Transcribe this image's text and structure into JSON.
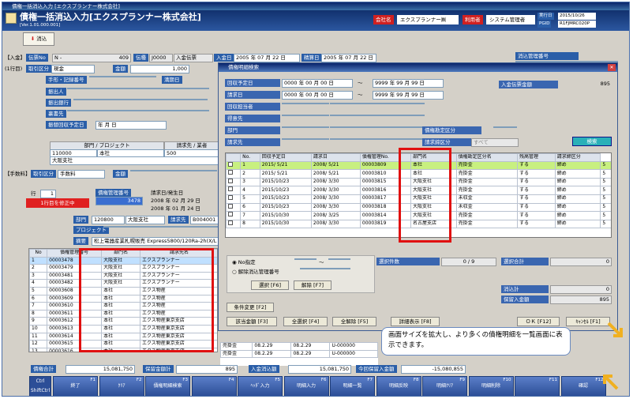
{
  "window": {
    "title": "債権一括消込入力 [エクスプランナー株式会社]"
  },
  "header": {
    "title": "債権一括消込入力[エクスプランナー株式会社]",
    "version": "[Ver.1.01.000.001]",
    "company_label": "会社名",
    "company": "エクスプランナー㈱",
    "user_label": "利用者",
    "user": "システム管理者",
    "date_label": "実行日",
    "date": "2015/10/26",
    "pgid_label": "PGID",
    "pgid": "R1FJMRC020P"
  },
  "toolbar": {
    "clear_label": "消込"
  },
  "main": {
    "entry_tag": "【入金】",
    "slip_no_label": "伝票No",
    "slip_no_prefix": "N -",
    "slip_no": "409",
    "voucher_label": "伝種",
    "voucher_code": "J0000",
    "voucher_name": "入金伝票",
    "payment_date_label": "入金日",
    "payment_date": "2005 年 07 月 22 日",
    "settle_date_label": "精算日",
    "settle_date": "2005 年 07 月 22 日",
    "clear_mgmt_label": "消込管理番号",
    "row_label": "(1行目)",
    "deal_type_label": "取引区分",
    "deal_type": "現金",
    "amount_label": "金額",
    "amount": "1,000",
    "note_row1": "手形・記録番号",
    "maturity_label": "満期日",
    "drawer_label": "振出人",
    "drawer_bank_label": "振出銀行",
    "endorser_label": "裏書先",
    "endorse_date_label": "振替回収予定日",
    "endorse_date": "年    月    日",
    "dept_header": "部門 / プロジェクト",
    "dept_value": "本社",
    "dept_code": "110000",
    "account_header": "請求先 / 業者",
    "account_value": "大阪支社",
    "account_code": "500",
    "fee_tag": "【手数料】",
    "fee_type_label": "取引区分",
    "fee_type": "手数料",
    "fee_amount_label": "金額",
    "row_no_label": "行",
    "row_no": "1",
    "correction_label": "1行目を修正中",
    "debt_no_label": "債権管理番号",
    "debt_no_value": "3478",
    "bill_date_label": "請求日/発生日",
    "bill_date1": "2008 年 02 月 29 日",
    "bill_date2": "2008 年 01 月 24 日",
    "section_label": "部門",
    "section_code": "120800",
    "section_name": "大阪支社",
    "bill_to_label": "請求先",
    "bill_to_code": "B004001",
    "project_label": "プロジェクト",
    "summary_label": "摘要",
    "summary": "松上電器産業札幌販売 Express5800/120Ra-2h(X/L"
  },
  "left_table": {
    "headers": [
      "No",
      "債権管理番号",
      "部門名",
      "請求先名"
    ],
    "rows": [
      [
        "1",
        "00003478",
        "大阪支社",
        "エクスプランナー"
      ],
      [
        "2",
        "00003479",
        "大阪支社",
        "エクスプランナー"
      ],
      [
        "3",
        "00003481",
        "大阪支社",
        "エクスプランナー"
      ],
      [
        "4",
        "00003482",
        "大阪支社",
        "エクスプランナー"
      ],
      [
        "5",
        "00003608",
        "本社",
        "エクス物産"
      ],
      [
        "6",
        "00003609",
        "本社",
        "エクス物産"
      ],
      [
        "7",
        "00003610",
        "本社",
        "エクス物産"
      ],
      [
        "8",
        "00003611",
        "本社",
        "エクス物産"
      ],
      [
        "9",
        "00003612",
        "本社",
        "エクス物産東京支店"
      ],
      [
        "10",
        "00003613",
        "本社",
        "エクス物産東京支店"
      ],
      [
        "11",
        "00003614",
        "本社",
        "エクス物産東京支店"
      ],
      [
        "12",
        "00003615",
        "本社",
        "エクス物産東京支店"
      ],
      [
        "13",
        "00003616",
        "本社",
        "エクス物産東京支店"
      ]
    ]
  },
  "behind_rows": [
    [
      "売掛金",
      "08.2.29",
      "08.2.29",
      "U-000000"
    ],
    [
      "売掛金",
      "08.2.29",
      "08.2.29",
      "U-000000"
    ]
  ],
  "dialog": {
    "title": "債権明細検索",
    "collect_date_label": "回収予定日",
    "collect_from": "0000 年 00 月 00 日",
    "collect_to": "9999 年 99 月 99 日",
    "tilde": "～",
    "bill_date_label": "請求日",
    "bill_from": "0000 年 00 月 00 日",
    "bill_to": "9999 年 99 月 99 日",
    "collector_label": "回収担当者",
    "customer_label": "得意先",
    "dept_label": "部門",
    "billto_label": "請求先",
    "payslip_amount_label": "入金伝票金額",
    "payslip_amount": "895",
    "debt_account_label": "債権勘定区分",
    "close_type_label": "請求締区分",
    "close_type_value": "すべて",
    "search_button": "検索",
    "headers": [
      "",
      "No.",
      "回収予定日",
      "請求日",
      "債権管理No.",
      "部門名",
      "債権勘定区分名",
      "残高管理",
      "請求締区分"
    ],
    "rows": [
      [
        "1",
        "2015/ 5/21",
        "2008/ 5/21",
        "00003809",
        "本社",
        "売掛金",
        "する",
        "締め",
        "5"
      ],
      [
        "2",
        "2015/ 5/21",
        "2008/ 5/21",
        "00003810",
        "本社",
        "売掛金",
        "する",
        "締め",
        "5"
      ],
      [
        "3",
        "2015/10/23",
        "2008/ 3/30",
        "00003815",
        "大阪支社",
        "売掛金",
        "する",
        "締め",
        "5"
      ],
      [
        "4",
        "2015/10/23",
        "2008/ 3/30",
        "00003816",
        "大阪支社",
        "売掛金",
        "する",
        "締め",
        "5"
      ],
      [
        "5",
        "2015/10/23",
        "2008/ 3/30",
        "00003817",
        "大阪支社",
        "未収金",
        "する",
        "締め",
        "5"
      ],
      [
        "6",
        "2015/10/23",
        "2008/ 3/30",
        "00003818",
        "大阪支社",
        "未収金",
        "する",
        "締め",
        "5"
      ],
      [
        "7",
        "2015/10/30",
        "2008/ 3/25",
        "00003814",
        "大阪支社",
        "売掛金",
        "する",
        "締め",
        "5"
      ],
      [
        "8",
        "2015/10/30",
        "2008/ 3/30",
        "00003819",
        "名古屋支店",
        "売掛金",
        "する",
        "締め",
        "5"
      ]
    ],
    "select_count_label": "選択件数",
    "select_count": "0 / 9",
    "select_total_label": "選択合計",
    "select_total": "0",
    "no_spec_label": "No指定",
    "release_label": "解除消込管理番号",
    "select_btn": "選択 [F6]",
    "release_btn": "解除 [F7]",
    "clear_total_label": "消込計",
    "clear_total": "0",
    "hold_amount_label": "保留入金額",
    "hold_amount": "895",
    "cond_change_btn": "条件変更 [F2]",
    "remain_btn": "該当金額 [F3]",
    "all_select_btn": "全選択 [F4]",
    "all_release_btn": "全解除 [F5]",
    "detail_btn": "詳細表示 [F8]",
    "ok_btn": "ＯＫ [F12]",
    "cancel_btn": "ｷｬﾝｾﾙ [F1]"
  },
  "footer": {
    "debt_total_label": "債権合計",
    "debt_total": "15,081,750",
    "hold_total_label": "保留金額計",
    "hold_total": "895",
    "payment_total_label": "入金消込額",
    "payment_total": "15,081,750",
    "this_time_label": "今回保留入金額",
    "this_time": "-15,080,855"
  },
  "fkeys": [
    {
      "n": "F1",
      "l": "終了"
    },
    {
      "n": "F2",
      "l": "ｸﾘｱ"
    },
    {
      "n": "F3",
      "l": "債権明細検索"
    },
    {
      "n": "F4",
      "l": ""
    },
    {
      "n": "F5",
      "l": "ﾍｯﾀﾞ入力"
    },
    {
      "n": "F6",
      "l": "明細入力"
    },
    {
      "n": "F7",
      "l": "明細一覧"
    },
    {
      "n": "F8",
      "l": "明細反映"
    },
    {
      "n": "F9",
      "l": "明細ｸﾘｱ"
    },
    {
      "n": "F10",
      "l": "明細削除"
    },
    {
      "n": "F11",
      "l": ""
    },
    {
      "n": "F12",
      "l": "確認"
    }
  ],
  "ctrl_keys": {
    "ctrl": "Ctrl",
    "shift": "ShiftCtrl"
  },
  "annotation": "画面サイズを拡大し、より多くの債権明細を一覧画面に表示できます。",
  "colors": {
    "accent": "#2a5ea8",
    "highlight_row": "#c8f080",
    "callout_border": "#e01010",
    "annotation_arrow": "#f0b020"
  }
}
